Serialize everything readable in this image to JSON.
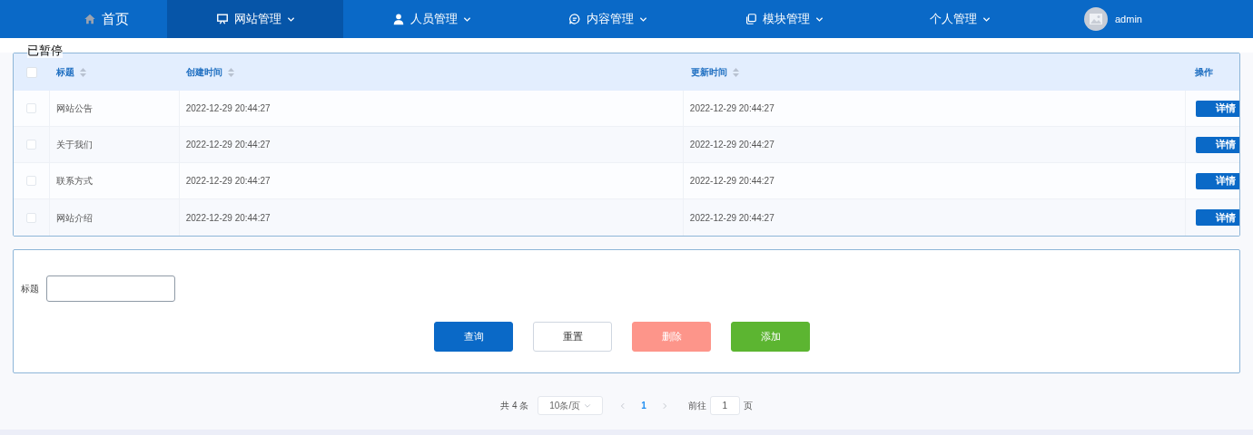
{
  "nav": {
    "items": [
      {
        "label": "首页",
        "selected": false,
        "dropdown": false
      },
      {
        "label": "网站管理",
        "selected": true,
        "dropdown": true
      },
      {
        "label": "人员管理",
        "selected": false,
        "dropdown": true
      },
      {
        "label": "内容管理",
        "selected": false,
        "dropdown": true
      },
      {
        "label": "模块管理",
        "selected": false,
        "dropdown": true
      },
      {
        "label": "个人管理",
        "selected": false,
        "dropdown": true
      }
    ],
    "user": "admin"
  },
  "overlay_text": "已暂停",
  "table": {
    "all_checked": false,
    "columns": [
      "标题",
      "创建时间",
      "更新时间",
      "操作"
    ],
    "rows": [
      {
        "checked": false,
        "title": "网站公告",
        "created": "2022-12-29 20:44:27",
        "updated": "2022-12-29 20:44:27",
        "action": "详情"
      },
      {
        "checked": false,
        "title": "关于我们",
        "created": "2022-12-29 20:44:27",
        "updated": "2022-12-29 20:44:27",
        "action": "详情"
      },
      {
        "checked": false,
        "title": "联系方式",
        "created": "2022-12-29 20:44:27",
        "updated": "2022-12-29 20:44:27",
        "action": "详情"
      },
      {
        "checked": false,
        "title": "网站介绍",
        "created": "2022-12-29 20:44:27",
        "updated": "2022-12-29 20:44:27",
        "action": "详情"
      }
    ]
  },
  "search": {
    "label": "标题",
    "buttons": [
      {
        "label": "查询",
        "kind": "primary"
      },
      {
        "label": "重置",
        "kind": "default"
      },
      {
        "label": "删除",
        "kind": "danger"
      },
      {
        "label": "添加",
        "kind": "success"
      }
    ]
  },
  "pagination": {
    "total": "共 4 条",
    "page_size": "10条/页",
    "pages": [
      {
        "label": "1",
        "selected": true
      }
    ],
    "goto_label": "前往",
    "goto_value": "1",
    "goto_suffix": "页"
  }
}
